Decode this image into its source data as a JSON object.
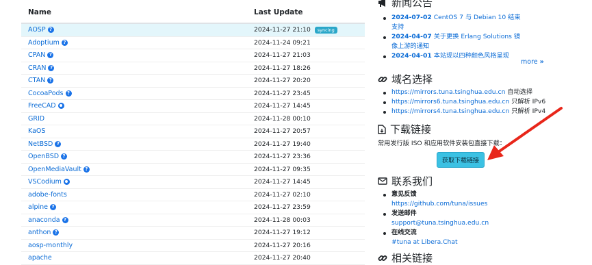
{
  "table": {
    "headers": {
      "name": "Name",
      "last_update": "Last Update"
    },
    "rows": [
      {
        "name": "AOSP",
        "date": "2024-11-27 21:10",
        "badge": "syncing",
        "icon": "help-icon"
      },
      {
        "name": "Adoptium",
        "date": "2024-11-24 09:21",
        "icon": "help-icon"
      },
      {
        "name": "CPAN",
        "date": "2024-11-27 21:03",
        "icon": "help-icon"
      },
      {
        "name": "CRAN",
        "date": "2024-11-27 18:26",
        "icon": "help-icon"
      },
      {
        "name": "CTAN",
        "date": "2024-11-27 20:20",
        "icon": "help-icon"
      },
      {
        "name": "CocoaPods",
        "date": "2024-11-27 23:45",
        "icon": "help-icon"
      },
      {
        "name": "FreeCAD",
        "date": "2024-11-27 14:45",
        "icon": "github-icon"
      },
      {
        "name": "GRID",
        "date": "2024-11-28 00:10"
      },
      {
        "name": "KaOS",
        "date": "2024-11-27 20:57"
      },
      {
        "name": "NetBSD",
        "date": "2024-11-27 19:40",
        "icon": "help-icon"
      },
      {
        "name": "OpenBSD",
        "date": "2024-11-27 23:36",
        "icon": "help-icon"
      },
      {
        "name": "OpenMediaVault",
        "date": "2024-11-27 09:35",
        "icon": "help-icon"
      },
      {
        "name": "VSCodium",
        "date": "2024-11-27 14:45",
        "icon": "github-icon"
      },
      {
        "name": "adobe-fonts",
        "date": "2024-11-27 02:10"
      },
      {
        "name": "alpine",
        "date": "2024-11-27 23:59",
        "icon": "help-icon"
      },
      {
        "name": "anaconda",
        "date": "2024-11-28 00:03",
        "icon": "help-icon"
      },
      {
        "name": "anthon",
        "date": "2024-11-27 19:12",
        "icon": "help-icon"
      },
      {
        "name": "aosp-monthly",
        "date": "2024-11-27 20:16"
      },
      {
        "name": "apache",
        "date": "2024-11-27 20:40"
      }
    ]
  },
  "news": {
    "title": "新闻公告",
    "items": [
      {
        "date": "2024-07-02",
        "text": "CentOS 7 与 Debian 10 结束支持"
      },
      {
        "date": "2024-04-07",
        "text": "关于更换 Erlang Solutions 镜像上游的通知"
      },
      {
        "date": "2024-04-01",
        "text": "本站现以四种颜色风格呈现"
      }
    ],
    "more": "more"
  },
  "domain": {
    "title": "域名选择",
    "items": [
      {
        "url": "https://mirrors.tuna.tsinghua.edu.cn",
        "note": "自动选择"
      },
      {
        "url": "https://mirrors6.tuna.tsinghua.edu.cn",
        "note": "只解析 IPv6"
      },
      {
        "url": "https://mirrors4.tuna.tsinghua.edu.cn",
        "note": "只解析 IPv4"
      }
    ]
  },
  "download": {
    "title": "下载链接",
    "desc": "常用发行版 ISO 和应用软件安装包直接下载：",
    "button": "获取下载链接"
  },
  "contact": {
    "title": "联系我们",
    "items": [
      {
        "label": "意见反馈",
        "link": "https://github.com/tuna/issues"
      },
      {
        "label": "发送邮件",
        "link": "support@tuna.tsinghua.edu.cn"
      },
      {
        "label": "在线交流",
        "link": "#tuna at Libera.Chat"
      }
    ]
  },
  "related": {
    "title": "相关链接"
  },
  "colors": {
    "link": "#0a6bd6",
    "syncing_badge": "#2aa7c9",
    "button": "#3bc1e3",
    "arrow": "#e8261a"
  }
}
